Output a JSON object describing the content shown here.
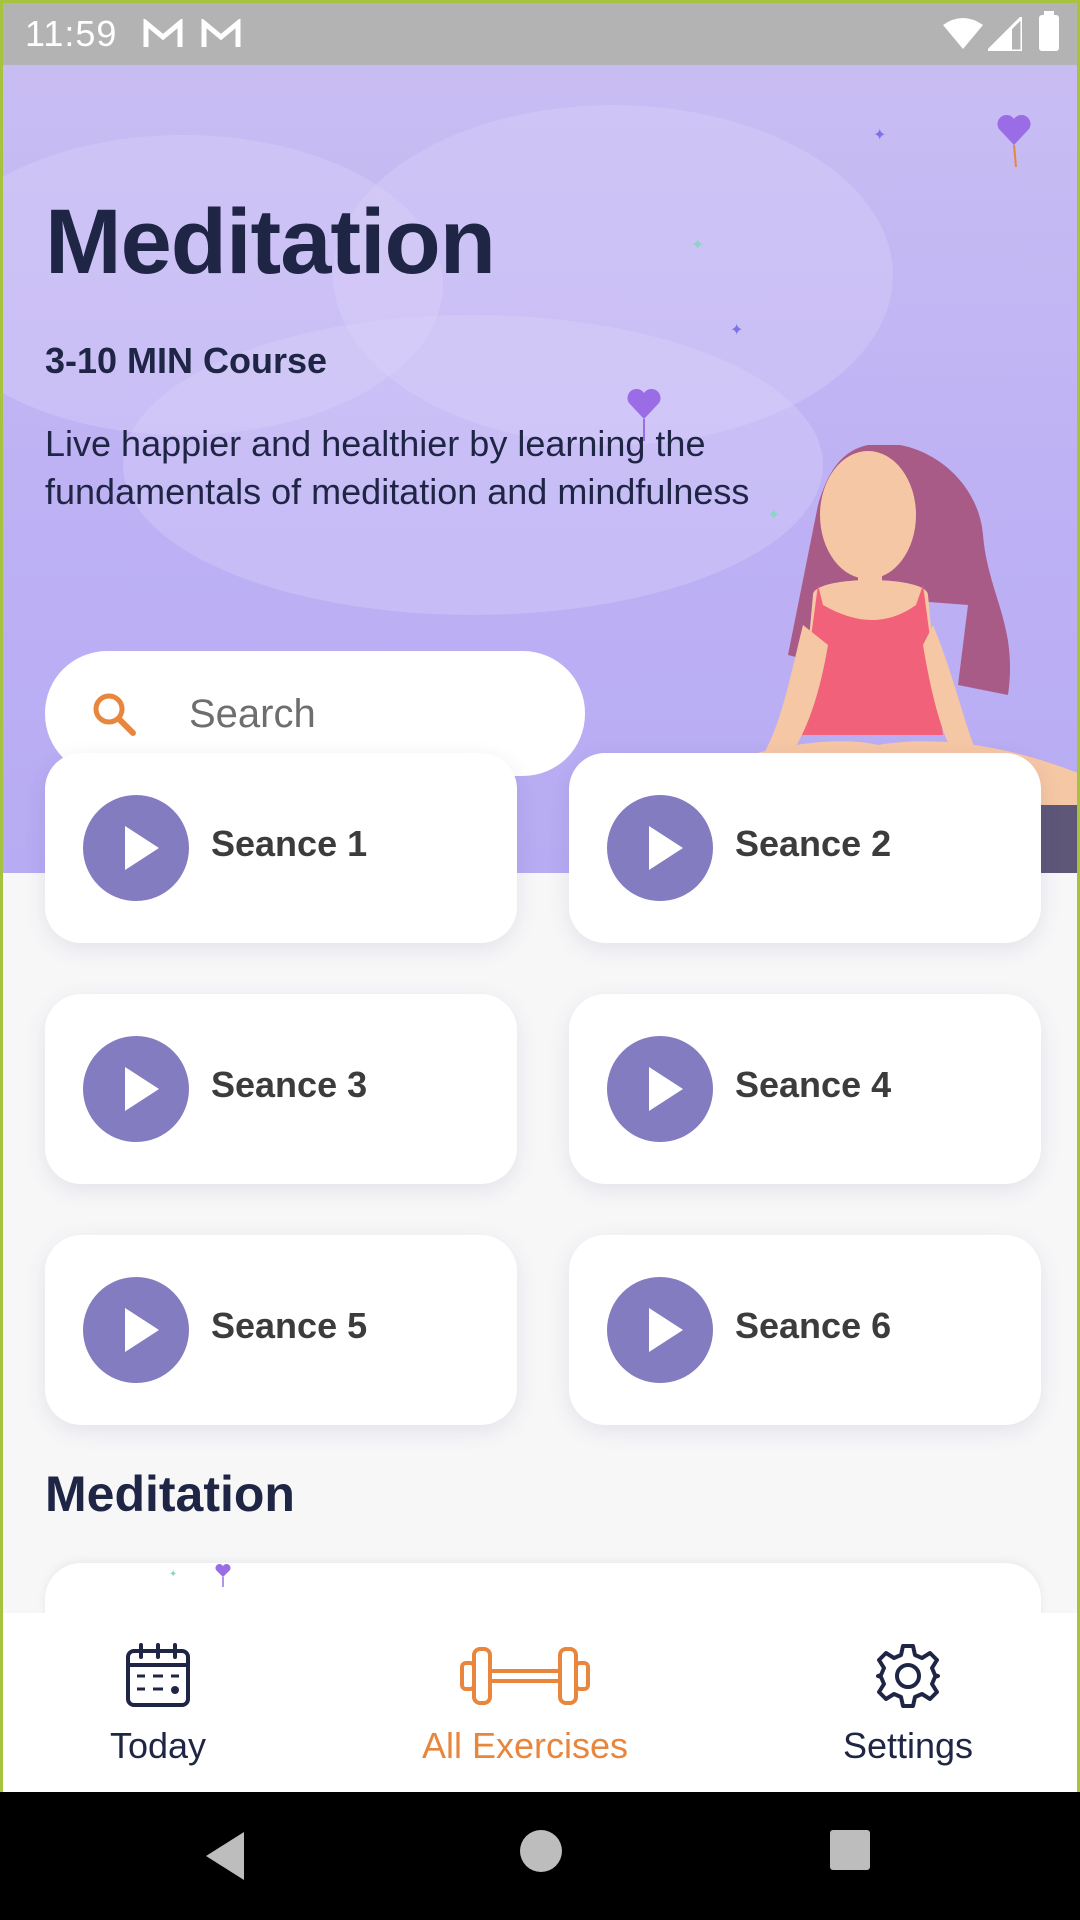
{
  "status_bar": {
    "time": "11:59"
  },
  "hero": {
    "title": "Meditation",
    "subtitle": "3-10 MIN Course",
    "description": "Live happier and healthier by learning the fundamentals of meditation and mindfulness",
    "search_placeholder": "Search"
  },
  "sessions": [
    {
      "label": "Seance 1"
    },
    {
      "label": "Seance 2"
    },
    {
      "label": "Seance 3"
    },
    {
      "label": "Seance 4"
    },
    {
      "label": "Seance 5"
    },
    {
      "label": "Seance 6"
    }
  ],
  "section": {
    "title": "Meditation"
  },
  "bottom_nav": {
    "items": [
      {
        "label": "Today",
        "icon": "calendar-icon"
      },
      {
        "label": "All Exercises",
        "icon": "dumbbell-icon",
        "active": true
      },
      {
        "label": "Settings",
        "icon": "gear-icon"
      }
    ]
  },
  "colors": {
    "accent": "#E8863E",
    "play": "#847CC1",
    "title": "#1F2545",
    "hero_bg": "#BDB0F4"
  }
}
